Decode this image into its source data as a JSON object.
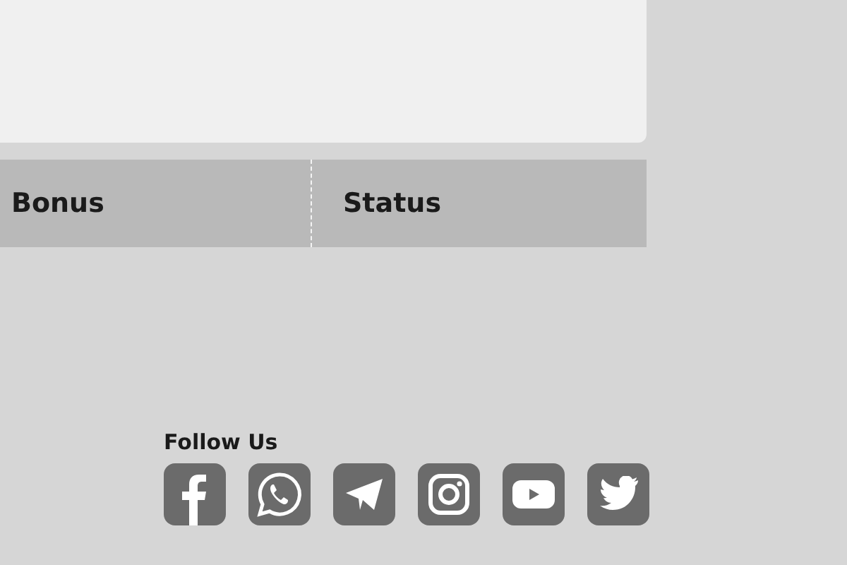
{
  "table": {
    "columns": [
      "Bonus",
      "Status"
    ]
  },
  "footer": {
    "title": "Follow Us"
  }
}
